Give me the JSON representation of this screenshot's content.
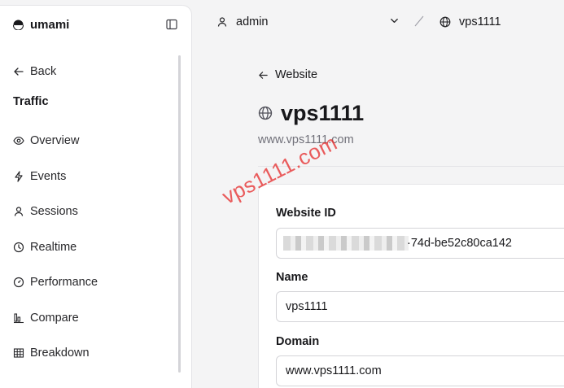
{
  "brand": {
    "name": "umami"
  },
  "sidebar": {
    "back_label": "Back",
    "section_title": "Traffic",
    "items": [
      {
        "label": "Overview",
        "icon": "eye-icon"
      },
      {
        "label": "Events",
        "icon": "lightning-icon"
      },
      {
        "label": "Sessions",
        "icon": "user-icon"
      },
      {
        "label": "Realtime",
        "icon": "clock-icon"
      },
      {
        "label": "Performance",
        "icon": "gauge-icon"
      },
      {
        "label": "Compare",
        "icon": "bar-chart-icon"
      },
      {
        "label": "Breakdown",
        "icon": "table-icon"
      }
    ]
  },
  "topbar": {
    "user": "admin",
    "website": "vps1111"
  },
  "main": {
    "back_link": "Website",
    "title": "vps1111",
    "domain": "www.vps1111.com",
    "fields": {
      "website_id_label": "Website ID",
      "website_id_visible": "·74d-be52c80ca142",
      "name_label": "Name",
      "name_value": "vps1111",
      "domain_label": "Domain",
      "domain_value": "www.vps1111.com"
    }
  },
  "watermark": "vps1111.com",
  "colors": {
    "background": "#f4f4f5",
    "surface": "#ffffff",
    "border": "#e4e4e7",
    "muted_text": "#71717a",
    "watermark": "#e62828"
  }
}
